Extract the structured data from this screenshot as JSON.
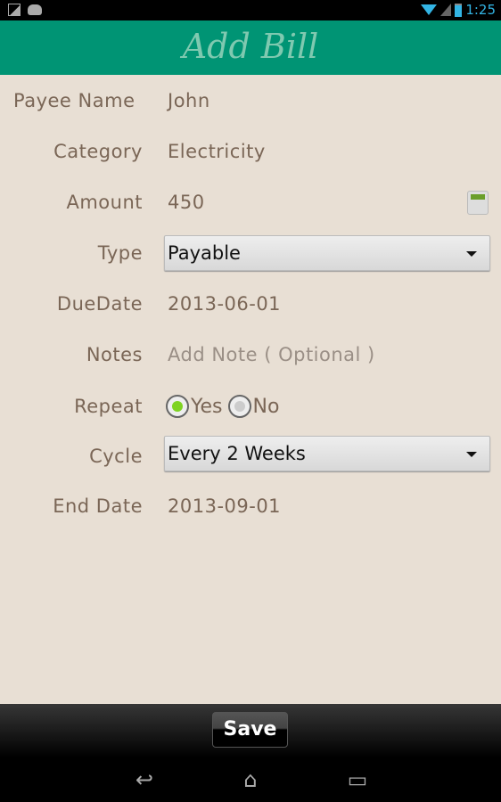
{
  "status": {
    "time": "1:25",
    "icons": [
      "image-icon",
      "android-icon",
      "wifi-icon",
      "signal-icon",
      "battery-charging-icon"
    ]
  },
  "header": {
    "title": "Add Bill"
  },
  "form": {
    "payee": {
      "label": "Payee Name",
      "value": "John"
    },
    "category": {
      "label": "Category",
      "value": "Electricity"
    },
    "amount": {
      "label": "Amount",
      "value": "450",
      "icon": "calculator-icon"
    },
    "type": {
      "label": "Type",
      "value": "Payable"
    },
    "due_date": {
      "label": "DueDate",
      "value": "2013-06-01"
    },
    "notes": {
      "label": "Notes",
      "placeholder": "Add Note ( Optional )"
    },
    "repeat": {
      "label": "Repeat",
      "options": [
        "Yes",
        "No"
      ],
      "selected": "Yes"
    },
    "cycle": {
      "label": "Cycle",
      "value": "Every 2 Weeks"
    },
    "end_date": {
      "label": "End Date",
      "value": "2013-09-01"
    }
  },
  "actions": {
    "save_label": "Save"
  },
  "nav": {
    "back": "↩",
    "home": "⌂",
    "recents": "▭"
  },
  "colors": {
    "header": "#009474",
    "background": "#e8dfd4",
    "label": "#7a6656",
    "radio_selected": "#7ed321"
  }
}
